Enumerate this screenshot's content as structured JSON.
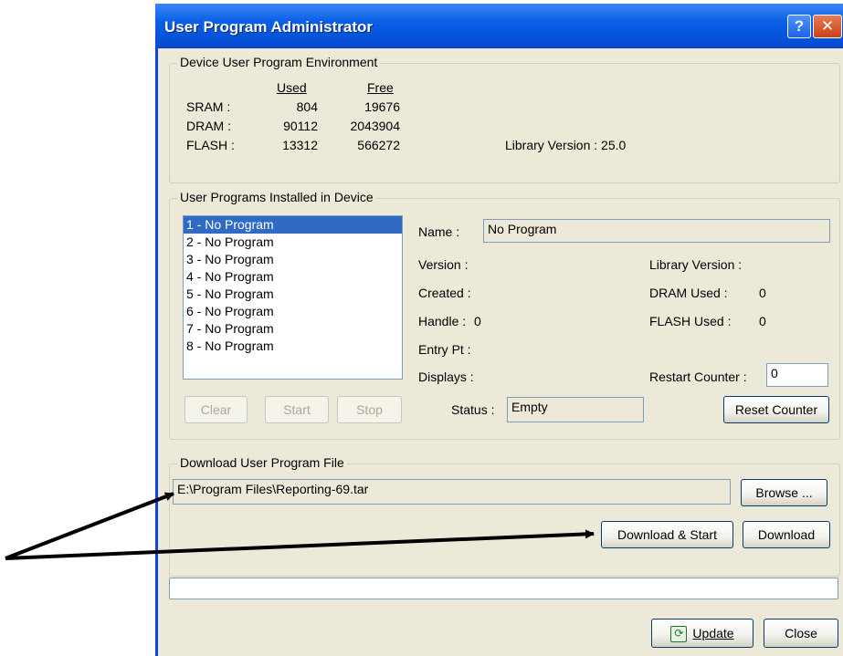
{
  "window": {
    "title": "User Program Administrator",
    "help_glyph": "?",
    "close_glyph": "✕"
  },
  "environment": {
    "legend": "Device User Program Environment",
    "col_used": "Used",
    "col_free": "Free",
    "rows": [
      {
        "label": "SRAM :",
        "used": "804",
        "free": "19676"
      },
      {
        "label": "DRAM :",
        "used": "90112",
        "free": "2043904"
      },
      {
        "label": "FLASH :",
        "used": "13312",
        "free": "566272"
      }
    ],
    "library_version": "Library Version : 25.0"
  },
  "programs": {
    "legend": "User Programs Installed in Device",
    "list": [
      "1 - No Program",
      "2 - No Program",
      "3 - No Program",
      "4 - No Program",
      "5 - No Program",
      "6 - No Program",
      "7 - No Program",
      "8 - No Program"
    ],
    "selected_index": 0,
    "buttons": {
      "clear": "Clear",
      "start": "Start",
      "stop": "Stop",
      "reset": "Reset Counter"
    },
    "name_label": "Name :",
    "name_value": "No Program",
    "version_label": "Version :",
    "created_label": "Created :",
    "handle_label": "Handle :",
    "handle_value": "0",
    "entry_label": "Entry Pt :",
    "displays_label": "Displays :",
    "status_label": "Status :",
    "status_value": "Empty",
    "libver_label": "Library Version :",
    "dram_label": "DRAM Used :",
    "dram_value": "0",
    "flash_label": "FLASH Used :",
    "flash_value": "0",
    "restart_label": "Restart Counter :",
    "restart_value": "0"
  },
  "download": {
    "legend": "Download User Program File",
    "path": "E:\\Program Files\\Reporting-69.tar",
    "browse": "Browse ...",
    "download_start": "Download & Start",
    "download": "Download"
  },
  "footer": {
    "update": "Update",
    "close": "Close"
  },
  "colors": {
    "titlebar": "#0551d8",
    "dialog_bg": "#ece9d8",
    "selection": "#316ac5",
    "arrow": "#000000"
  }
}
